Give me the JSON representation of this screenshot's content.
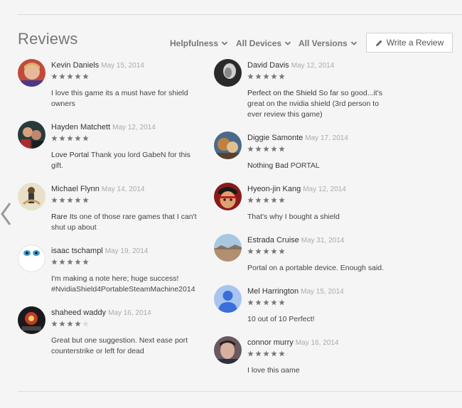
{
  "header": {
    "title": "Reviews",
    "write_review_label": "Write a Review"
  },
  "filters": [
    {
      "label": "Helpfulness"
    },
    {
      "label": "All Devices"
    },
    {
      "label": "All Versions"
    }
  ],
  "colors": {
    "star_filled": "#777777",
    "star_empty": "#d9d9d9",
    "background": "#f5f5f5"
  },
  "reviews": [
    {
      "author": "Kevin Daniels",
      "date": "May 15, 2014",
      "rating": 5,
      "title": "",
      "body": "I love this game its a must have for shield owners"
    },
    {
      "author": "Hayden Matchett",
      "date": "May 12, 2014",
      "rating": 5,
      "title": "Love Portal",
      "body": "Thank you lord GabeN for this gift."
    },
    {
      "author": "Michael Flynn",
      "date": "May 14, 2014",
      "rating": 5,
      "title": "Rare",
      "body": "Its one of those rare games that I can't shut up about"
    },
    {
      "author": "isaac tschampl",
      "date": "May 19, 2014",
      "rating": 5,
      "title": "",
      "body": "I'm making a note here; huge success! #NvidiaShield4PortableSteamMachine2014"
    },
    {
      "author": "shaheed waddy",
      "date": "May 16, 2014",
      "rating": 4,
      "title": "",
      "body": "Great but one suggestion. Next ease port counterstrike or left for dead"
    },
    {
      "author": "David Davis",
      "date": "May 12, 2014",
      "rating": 5,
      "title": "Perfect on the Shield",
      "body": "So far so good...it's great on the nvidia shield (3rd person to ever review this game)"
    },
    {
      "author": "Diggie Samonte",
      "date": "May 17, 2014",
      "rating": 5,
      "title": "Nothing Bad",
      "body": "PORTAL"
    },
    {
      "author": "Hyeon-jin Kang",
      "date": "May 12, 2014",
      "rating": 5,
      "title": "",
      "body": "That's why I bought a shield"
    },
    {
      "author": "Estrada Cruise",
      "date": "May 31, 2014",
      "rating": 5,
      "title": "",
      "body": "Portal on a portable device. Enough said."
    },
    {
      "author": "Mel Harrington",
      "date": "May 15, 2014",
      "rating": 5,
      "title": "",
      "body": "10 out of 10 Perfect!"
    },
    {
      "author": "connor murry",
      "date": "May 16, 2014",
      "rating": 5,
      "title": "",
      "body": "I love this game"
    }
  ]
}
